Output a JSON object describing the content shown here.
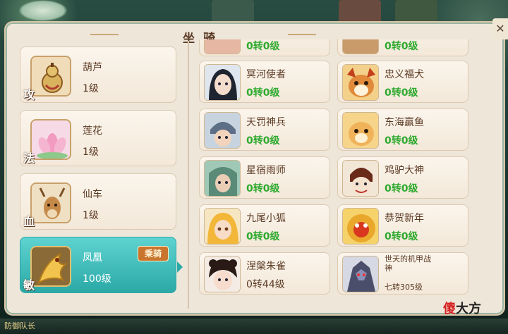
{
  "window": {
    "title": "坐骑",
    "close_label": "✕"
  },
  "mounts": [
    {
      "name": "葫芦",
      "level": "1级",
      "type": "攻",
      "icon": "gourd-icon",
      "selected": false
    },
    {
      "name": "莲花",
      "level": "1级",
      "type": "法",
      "icon": "lotus-icon",
      "selected": false
    },
    {
      "name": "仙车",
      "level": "1级",
      "type": "血",
      "icon": "deer-icon",
      "selected": false
    },
    {
      "name": "凤凰",
      "level": "100级",
      "type": "敏",
      "icon": "phoenix-icon",
      "selected": true,
      "badge": "乘骑"
    }
  ],
  "characters": [
    {
      "name": "",
      "reinc": "0转0级",
      "locked": false,
      "portrait": "top-cut-portrait-left"
    },
    {
      "name": "",
      "reinc": "0转0级",
      "locked": false,
      "portrait": "top-cut-portrait-right"
    },
    {
      "name": "冥河使者",
      "reinc": "0转0级",
      "locked": false,
      "portrait": "dark-haired-girl-portrait"
    },
    {
      "name": "忠义福犬",
      "reinc": "0转0级",
      "locked": false,
      "portrait": "dog-portrait"
    },
    {
      "name": "天罚神兵",
      "reinc": "0转0级",
      "locked": false,
      "portrait": "helmet-soldier-portrait"
    },
    {
      "name": "东海赢鱼",
      "reinc": "0转0级",
      "locked": false,
      "portrait": "fox-fish-portrait"
    },
    {
      "name": "星宿雨师",
      "reinc": "0转0级",
      "locked": false,
      "portrait": "green-warrior-portrait"
    },
    {
      "name": "鸡驴大神",
      "reinc": "0转0级",
      "locked": false,
      "portrait": "donkey-portrait"
    },
    {
      "name": "九尾小狐",
      "reinc": "0转0级",
      "locked": false,
      "portrait": "blonde-girl-portrait"
    },
    {
      "name": "恭贺新年",
      "reinc": "0转0级",
      "locked": false,
      "portrait": "lion-dance-portrait"
    },
    {
      "name": "涅槃朱雀",
      "reinc": "0转44级",
      "locked": true,
      "portrait": "maiden-portrait"
    },
    {
      "name": "世天的机甲战神",
      "reinc": "七转305级",
      "locked": true,
      "portrait": "mecha-portrait"
    }
  ],
  "bottom": {
    "text": "防御队长"
  },
  "watermark": {
    "red": "傻",
    "black": "大方"
  },
  "colors": {
    "accent": "#2aa9a7",
    "green_level": "#2faa2f",
    "panel_bg": "#efe6da",
    "text_brown": "#5b3a24"
  }
}
